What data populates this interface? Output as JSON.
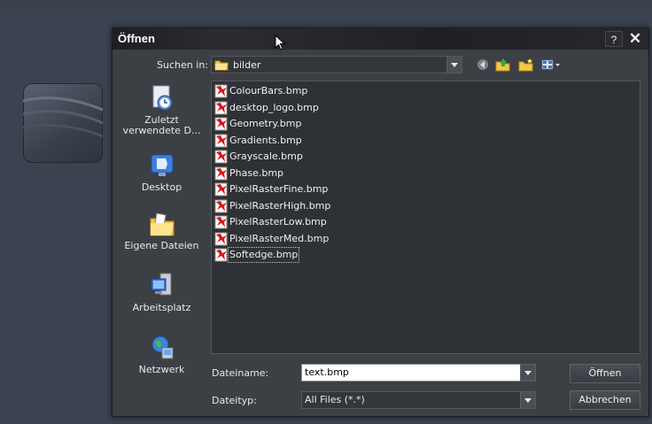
{
  "dialog": {
    "title": "Öffnen",
    "help_label": "?",
    "close_label": "✕"
  },
  "lookin": {
    "label": "Suchen in:",
    "value": "bilder"
  },
  "toolbar": {
    "icons": [
      "back-icon",
      "up-folder-icon",
      "new-folder-icon",
      "view-menu-icon"
    ]
  },
  "places": [
    {
      "label": "Zuletzt verwendete D...",
      "icon": "recent-documents-icon"
    },
    {
      "label": "Desktop",
      "icon": "desktop-icon"
    },
    {
      "label": "Eigene Dateien",
      "icon": "my-documents-icon"
    },
    {
      "label": "Arbeitsplatz",
      "icon": "my-computer-icon"
    },
    {
      "label": "Netzwerk",
      "icon": "network-icon"
    }
  ],
  "files": [
    "ColourBars.bmp",
    "desktop_logo.bmp",
    "Geometry.bmp",
    "Gradients.bmp",
    "Grayscale.bmp",
    "Phase.bmp",
    "PixelRasterFine.bmp",
    "PixelRasterHigh.bmp",
    "PixelRasterLow.bmp",
    "PixelRasterMed.bmp",
    "Softedge.bmp"
  ],
  "filename": {
    "label": "Dateiname:",
    "value": "text.bmp"
  },
  "filetype": {
    "label": "Dateityp:",
    "value": "All Files (*.*)"
  },
  "buttons": {
    "open": "Öffnen",
    "cancel": "Abbrechen"
  },
  "colors": {
    "dialog_bg": "#3c3f44",
    "titlebar_bg": "#1d1f23",
    "list_bg": "#2e3136",
    "file_icon_red": "#d81818"
  }
}
